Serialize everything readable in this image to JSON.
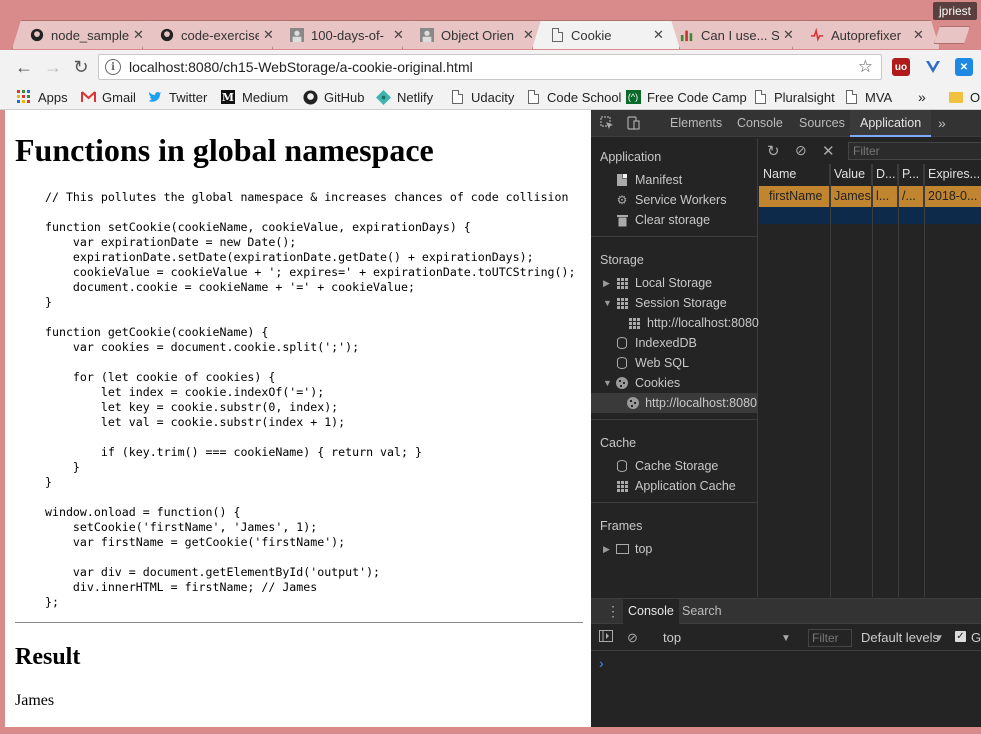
{
  "window": {
    "user": "jpriest"
  },
  "tabs": [
    {
      "label": "node_sample",
      "icon": "github-icon",
      "active": false
    },
    {
      "label": "code-exercise",
      "icon": "github-icon",
      "active": false
    },
    {
      "label": "100-days-of-",
      "icon": "avatar-icon",
      "active": false
    },
    {
      "label": "Object Orien",
      "icon": "avatar-icon",
      "active": false
    },
    {
      "label": "Cookie",
      "icon": "page-icon",
      "active": true
    },
    {
      "label": "Can I use... S",
      "icon": "caniuse-icon",
      "active": false
    },
    {
      "label": "Autoprefixer",
      "icon": "autoprefixer-icon",
      "active": false
    }
  ],
  "toolbar": {
    "url": "localhost:8080/ch15-WebStorage/a-cookie-original.html",
    "back": "←",
    "forward": "→",
    "reload": "↻",
    "star": "☆"
  },
  "bookmarks": [
    {
      "label": "Apps",
      "icon": "apps-grid-icon"
    },
    {
      "label": "Gmail",
      "icon": "gmail-icon"
    },
    {
      "label": "Twitter",
      "icon": "twitter-icon"
    },
    {
      "label": "Medium",
      "icon": "medium-icon"
    },
    {
      "label": "GitHub",
      "icon": "github-icon"
    },
    {
      "label": "Netlify",
      "icon": "netlify-icon"
    },
    {
      "label": "Udacity",
      "icon": "page-icon"
    },
    {
      "label": "Code School",
      "icon": "page-icon"
    },
    {
      "label": "Free Code Camp",
      "icon": "freecodecamp-icon"
    },
    {
      "label": "Pluralsight",
      "icon": "page-icon"
    },
    {
      "label": "MVA",
      "icon": "page-icon"
    }
  ],
  "bookmarks_more": "»",
  "bookmarks_overflow": "O",
  "page": {
    "heading": "Functions in global namespace",
    "code": "// This pollutes the global namespace & increases chances of code collision\n\nfunction setCookie(cookieName, cookieValue, expirationDays) {\n    var expirationDate = new Date();\n    expirationDate.setDate(expirationDate.getDate() + expirationDays);\n    cookieValue = cookieValue + '; expires=' + expirationDate.toUTCString();\n    document.cookie = cookieName + '=' + cookieValue;\n}\n\nfunction getCookie(cookieName) {\n    var cookies = document.cookie.split(';');\n\n    for (let cookie of cookies) {\n        let index = cookie.indexOf('=');\n        let key = cookie.substr(0, index);\n        let val = cookie.substr(index + 1);\n\n        if (key.trim() === cookieName) { return val; }\n    }\n}\n\nwindow.onload = function() {\n    setCookie('firstName', 'James', 1);\n    var firstName = getCookie('firstName');\n\n    var div = document.getElementById('output');\n    div.innerHTML = firstName; // James\n};",
    "result_heading": "Result",
    "output": "James"
  },
  "devtools": {
    "tabs": [
      "Elements",
      "Console",
      "Sources",
      "Application"
    ],
    "active_tab": "Application",
    "more": "»",
    "sidebar": {
      "application": {
        "title": "Application",
        "items": [
          "Manifest",
          "Service Workers",
          "Clear storage"
        ]
      },
      "storage": {
        "title": "Storage",
        "local_storage": "Local Storage",
        "session_storage": "Session Storage",
        "session_origin": "http://localhost:8080",
        "indexeddb": "IndexedDB",
        "websql": "Web SQL",
        "cookies": "Cookies",
        "cookies_origin": "http://localhost:8080"
      },
      "cache": {
        "title": "Cache",
        "items": [
          "Cache Storage",
          "Application Cache"
        ]
      },
      "frames": {
        "title": "Frames",
        "top": "top"
      }
    },
    "filter_placeholder": "Filter",
    "cookie_table": {
      "columns": [
        "Name",
        "Value",
        "D...",
        "P...",
        "Expires..."
      ],
      "rows": [
        [
          "firstName",
          "James",
          "l...",
          "/...",
          "2018-0..."
        ]
      ]
    },
    "drawer": {
      "tabs": [
        "Console",
        "Search"
      ],
      "context": "top",
      "filter_placeholder": "Filter",
      "levels": "Default levels",
      "levels_cut": "G",
      "prompt": "›"
    }
  }
}
